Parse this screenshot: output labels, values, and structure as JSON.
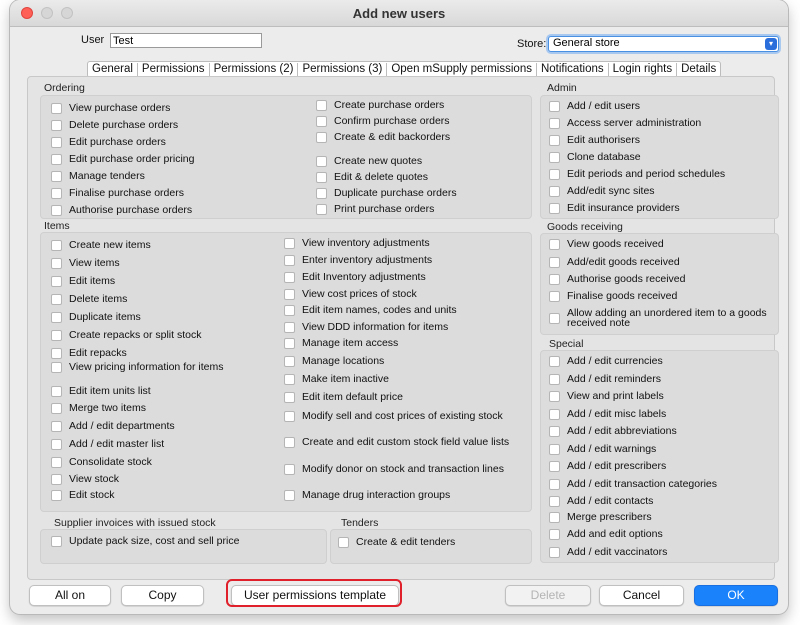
{
  "window": {
    "title": "Add new users"
  },
  "form": {
    "user_label": "User",
    "user_value": "Test",
    "store_label": "Store:",
    "store_value": "General store"
  },
  "tabs": [
    "General",
    "Permissions",
    "Permissions (2)",
    "Permissions (3)",
    "Open mSupply permissions",
    "Notifications",
    "Login rights",
    "Details"
  ],
  "ordering": {
    "title": "Ordering",
    "col1": [
      "View purchase orders",
      "Delete purchase orders",
      "Edit purchase orders",
      "Edit purchase order pricing",
      "Manage tenders",
      "Finalise purchase orders",
      "Authorise purchase orders"
    ],
    "col2": [
      "Create purchase orders",
      "Confirm purchase orders",
      "Create & edit backorders",
      "Create new quotes",
      "Edit & delete quotes",
      "Duplicate purchase orders",
      "Print purchase orders"
    ]
  },
  "items": {
    "title": "Items",
    "col1": [
      "Create new items",
      "View items",
      "Edit items",
      "Delete items",
      "Duplicate items",
      "Create repacks or split stock",
      "Edit repacks",
      "View pricing information for items",
      "Edit item units list",
      "Merge two items",
      "Add / edit departments",
      "Add / edit master list",
      "Consolidate stock",
      "View stock",
      "Edit stock"
    ],
    "col2": [
      "View inventory adjustments",
      "Enter inventory adjustments",
      "Edit Inventory adjustments",
      "View cost prices of stock",
      "Edit item names, codes and units",
      "View DDD information for items",
      "Manage item access",
      "Manage locations",
      "Make item inactive",
      "Edit item default price",
      "Modify sell and cost prices of existing stock",
      "Create and edit custom stock field value lists",
      "Modify donor on stock and transaction lines",
      "Manage drug interaction groups"
    ]
  },
  "supplier": {
    "title": "Supplier invoices with issued stock",
    "items": [
      "Update pack size, cost and sell price"
    ]
  },
  "tenders": {
    "title": "Tenders",
    "items": [
      "Create & edit tenders"
    ]
  },
  "admin": {
    "title": "Admin",
    "items": [
      "Add / edit users",
      "Access server administration",
      "Edit authorisers",
      "Clone database",
      "Edit periods and period schedules",
      "Add/edit sync sites",
      "Edit insurance providers"
    ]
  },
  "goods": {
    "title": "Goods receiving",
    "items": [
      "View goods received",
      "Add/edit goods received",
      "Authorise goods received",
      "Finalise goods received",
      "Allow adding an unordered item to a goods received note"
    ]
  },
  "special": {
    "title": "Special",
    "items": [
      "Add / edit currencies",
      "Add / edit reminders",
      "View and print labels",
      "Add / edit misc labels",
      "Add / edit abbreviations",
      "Add / edit warnings",
      "Add / edit prescribers",
      "Add / edit transaction categories",
      "Add / edit contacts",
      "Merge prescribers",
      "Add and edit options",
      "Add / edit vaccinators"
    ]
  },
  "buttons": {
    "all_on": "All on",
    "copy": "Copy",
    "template": "User permissions template",
    "delete": "Delete",
    "cancel": "Cancel",
    "ok": "OK"
  },
  "colors": {
    "accent": "#1a82fb",
    "highlight": "#e0202a",
    "close": "#fe5f57"
  }
}
